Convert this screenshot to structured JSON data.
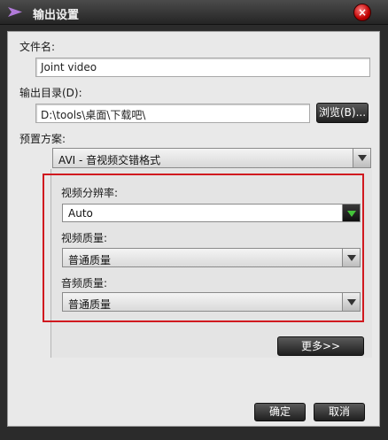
{
  "window": {
    "title": "输出设置",
    "close_symbol": "×",
    "icon": "app-arrow-icon"
  },
  "form": {
    "filename_label": "文件名:",
    "filename_value": "Joint video",
    "output_dir_label": "输出目录(D):",
    "output_dir_value": "D:\\tools\\桌面\\下载吧\\",
    "browse_button": "浏览(B)...",
    "preset_label": "预置方案:",
    "preset_value": "AVI - 音视频交错格式"
  },
  "video_settings": {
    "resolution_label": "视频分辨率:",
    "resolution_value": "Auto",
    "video_quality_label": "视频质量:",
    "video_quality_value": "普通质量",
    "audio_quality_label": "音频质量:",
    "audio_quality_value": "普通质量"
  },
  "buttons": {
    "more": "更多>>",
    "ok": "确定",
    "cancel": "取消"
  },
  "colors": {
    "highlight_box": "#d0191f",
    "accent_green": "#44c43a"
  }
}
